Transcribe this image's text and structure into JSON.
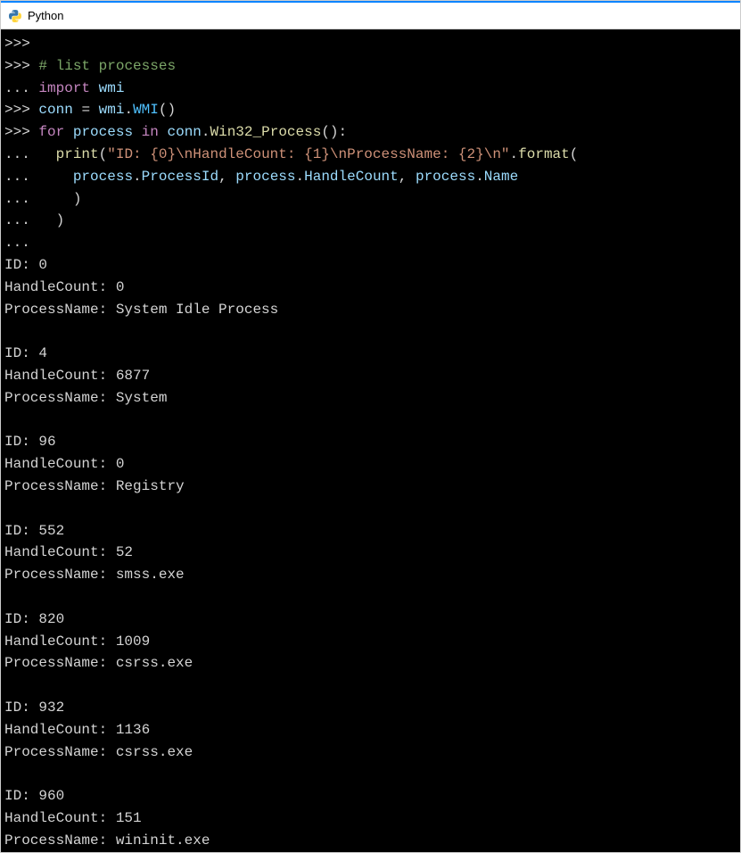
{
  "window": {
    "title": "Python"
  },
  "terminal": {
    "prompts": {
      "primary": ">>>",
      "continuation": "..."
    },
    "code": {
      "comment": "# list processes",
      "import_kw": "import",
      "import_mod": "wmi",
      "assign_lhs": "conn",
      "assign_rhs_mod": "wmi",
      "assign_rhs_cls": "WMI",
      "for_kw": "for",
      "for_var": "process",
      "in_kw": "in",
      "for_iter_obj": "conn",
      "for_iter_method": "Win32_Process",
      "print_fn": "print",
      "fmt_string": "\"ID: {0}\\nHandleCount: {1}\\nProcessName: {2}\\n\"",
      "format_method": "format",
      "arg1_obj": "process",
      "arg1_attr": "ProcessId",
      "arg2_obj": "process",
      "arg2_attr": "HandleCount",
      "arg3_obj": "process",
      "arg3_attr": "Name"
    },
    "labels": {
      "id": "ID:",
      "handle": "HandleCount:",
      "name": "ProcessName:"
    },
    "output": [
      {
        "id": "0",
        "handle": "0",
        "name": "System Idle Process"
      },
      {
        "id": "4",
        "handle": "6877",
        "name": "System"
      },
      {
        "id": "96",
        "handle": "0",
        "name": "Registry"
      },
      {
        "id": "552",
        "handle": "52",
        "name": "smss.exe"
      },
      {
        "id": "820",
        "handle": "1009",
        "name": "csrss.exe"
      },
      {
        "id": "932",
        "handle": "1136",
        "name": "csrss.exe"
      },
      {
        "id": "960",
        "handle": "151",
        "name": "wininit.exe"
      }
    ]
  }
}
